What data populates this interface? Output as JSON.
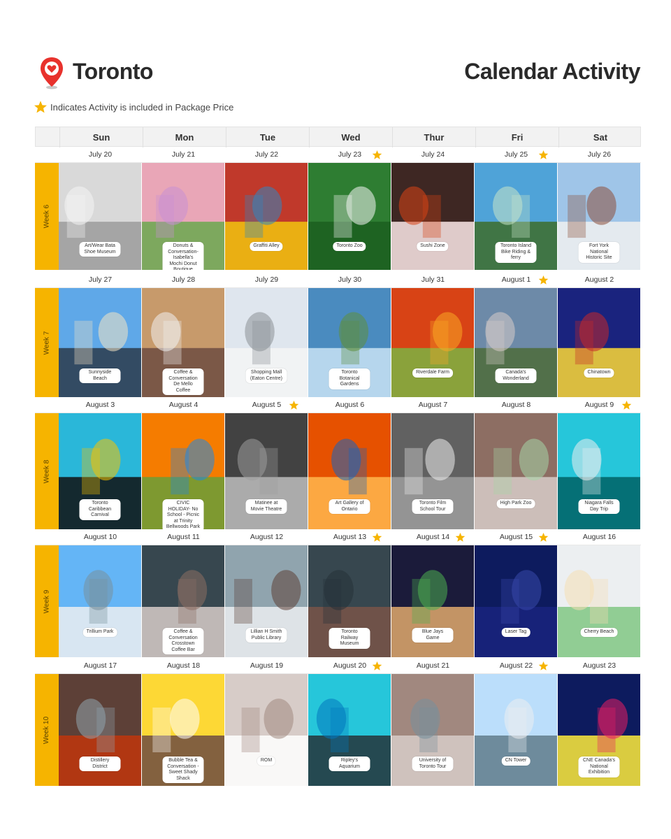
{
  "header": {
    "city": "Toronto",
    "title": "Calendar Activity",
    "pin_icon": "location-pin-heart-icon"
  },
  "legend": {
    "icon": "star-icon",
    "text": "Indicates Activity is included in Package Price"
  },
  "colors": {
    "accent": "#f6b400",
    "pin": "#e8322d",
    "star": "#f6b400"
  },
  "calendar": {
    "days": [
      "Sun",
      "Mon",
      "Tue",
      "Wed",
      "Thur",
      "Fri",
      "Sat"
    ],
    "weeks": [
      {
        "label": "Week 6",
        "dates": [
          {
            "date": "July 20",
            "star": false
          },
          {
            "date": "July 21",
            "star": false
          },
          {
            "date": "July 22",
            "star": false
          },
          {
            "date": "July 23",
            "star": true
          },
          {
            "date": "July 24",
            "star": false
          },
          {
            "date": "July 25",
            "star": true
          },
          {
            "date": "July 26",
            "star": false
          }
        ],
        "activities": [
          "Art/Wear Bata Shoe Museum",
          "Donuts & Conversation- Isabella's Mochi Donut Boutique",
          "Graffiti Alley",
          "Toronto Zoo",
          "Sushi Zone",
          "Toronto Island Bike Riding & ferry",
          "Fort York National Historic Site"
        ]
      },
      {
        "label": "Week 7",
        "dates": [
          {
            "date": "July 27",
            "star": false
          },
          {
            "date": "July 28",
            "star": false
          },
          {
            "date": "July 29",
            "star": false
          },
          {
            "date": "July 30",
            "star": false
          },
          {
            "date": "July 31",
            "star": false
          },
          {
            "date": "August 1",
            "star": true
          },
          {
            "date": "August 2",
            "star": false
          }
        ],
        "activities": [
          "Sunnyside Beach",
          "Coffee & Conversation De Mello Coffee",
          "Shopping Mall (Eaton Centre)",
          "Toronto Botanical Gardens",
          "Riverdale Farm",
          "Canada's Wonderland",
          "Chinatown"
        ]
      },
      {
        "label": "Week 8",
        "dates": [
          {
            "date": "August 3",
            "star": false
          },
          {
            "date": "August 4",
            "star": false
          },
          {
            "date": "August 5",
            "star": true
          },
          {
            "date": "August 6",
            "star": false
          },
          {
            "date": "August 7",
            "star": false
          },
          {
            "date": "August 8",
            "star": false
          },
          {
            "date": "August 9",
            "star": true
          }
        ],
        "activities": [
          "Toronto Caribbean Carnival",
          "CIVIC HOLIDAY- No School - Picnic at Trinity Bellwoods Park",
          "Matinee at Movie Theatre",
          "Art Gallery of Ontario",
          "Toronto Film School Tour",
          "High Park Zoo",
          "Niagara Falls Day Trip"
        ]
      },
      {
        "label": "Week 9",
        "dates": [
          {
            "date": "August 10",
            "star": false
          },
          {
            "date": "August 11",
            "star": false
          },
          {
            "date": "August 12",
            "star": false
          },
          {
            "date": "August 13",
            "star": true
          },
          {
            "date": "August 14",
            "star": true
          },
          {
            "date": "August 15",
            "star": true
          },
          {
            "date": "August 16",
            "star": false
          }
        ],
        "activities": [
          "Trillium Park",
          "Coffee & Conversation Crosstown Coffee Bar",
          "Lillian H Smith Public Library",
          "Toronto Railway Museum",
          "Blue Jays Game",
          "Laser Tag",
          "Cherry Beach"
        ]
      },
      {
        "label": "Week 10",
        "dates": [
          {
            "date": "August 17",
            "star": false
          },
          {
            "date": "August 18",
            "star": false
          },
          {
            "date": "August 19",
            "star": false
          },
          {
            "date": "August 20",
            "star": true
          },
          {
            "date": "August 21",
            "star": false
          },
          {
            "date": "August 22",
            "star": true
          },
          {
            "date": "August 23",
            "star": false
          }
        ],
        "activities": [
          "Distillery District",
          "Bubble Tea & Conversation - Sweet Shady Shack",
          "ROM",
          "Ripley's Aquarium",
          "University of Toronto Tour",
          "CN Tower",
          "CNE Canada's National Exhibition"
        ]
      }
    ]
  }
}
